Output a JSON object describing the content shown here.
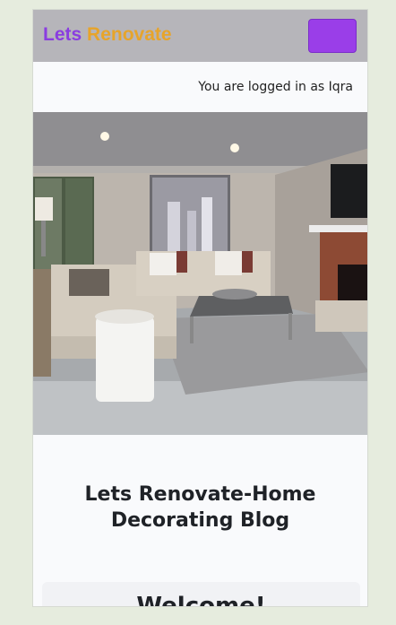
{
  "navbar": {
    "brand_part1": "Lets",
    "brand_part2": "Renovate"
  },
  "login_status": "You are logged in as Iqra",
  "hero": {
    "image_label": "living-room-photo"
  },
  "title": {
    "line1": "Lets Renovate-Home",
    "line2": "Decorating Blog"
  },
  "card": {
    "heading": "Welcome!"
  },
  "colors": {
    "accent": "#9a3ee8",
    "brand_purple": "#8a3de0",
    "brand_orange": "#e7a42a",
    "navbar_bg": "#b6b5ba",
    "page_bg": "#e6ecde"
  }
}
